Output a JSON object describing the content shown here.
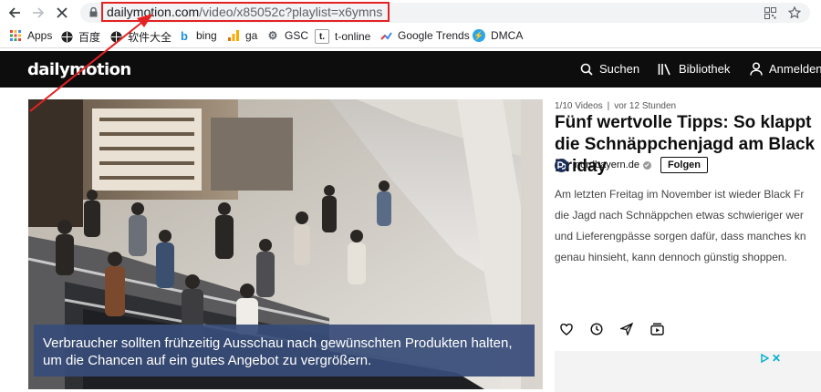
{
  "browser": {
    "url_host": "dailymotion.com",
    "url_path": "/video/x85052c?playlist=x6ymns",
    "bookmarks": [
      {
        "label": "Apps",
        "icon": "apps-grid-icon"
      },
      {
        "label": "百度",
        "icon": "globe-icon"
      },
      {
        "label": "软件大全",
        "icon": "globe-icon"
      },
      {
        "label": "bing",
        "icon": "bing-icon"
      },
      {
        "label": "ga",
        "icon": "analytics-icon"
      },
      {
        "label": "GSC",
        "icon": "search-console-icon"
      },
      {
        "label": "t-online",
        "icon": "t-online-icon"
      },
      {
        "label": "Google Trends",
        "icon": "trends-icon"
      },
      {
        "label": "DMCA",
        "icon": "dmca-icon"
      }
    ]
  },
  "site": {
    "logo": "dailymotion",
    "search_label": "Suchen",
    "library_label": "Bibliothek",
    "login_label": "Anmelden"
  },
  "video": {
    "caption": "Verbraucher sollten frühzeitig Ausschau nach gewünschten Produkten halten, um die Chancen auf ein gutes Angebot zu vergrößern."
  },
  "info": {
    "playlist_position": "1/10 Videos",
    "age": "vor 12 Stunden",
    "title": "Fünf wertvolle Tipps: So klappt die Schnäppchenjagd am Black Friday",
    "channel": "nordbayern.de",
    "follow_label": "Folgen",
    "description_lines": [
      "Am letzten Freitag im November ist wieder Black Fr",
      "die Jagd nach Schnäppchen etwas schwieriger wer",
      "und Lieferengpässe sorgen dafür, dass manches kn",
      "genau hinsieht, kann dennoch günstig shoppen."
    ]
  },
  "colors": {
    "header_bg": "#0d0d0d",
    "highlight": "#e52222",
    "caption_bg": "#384c78",
    "ad_accent": "#00aecd"
  }
}
